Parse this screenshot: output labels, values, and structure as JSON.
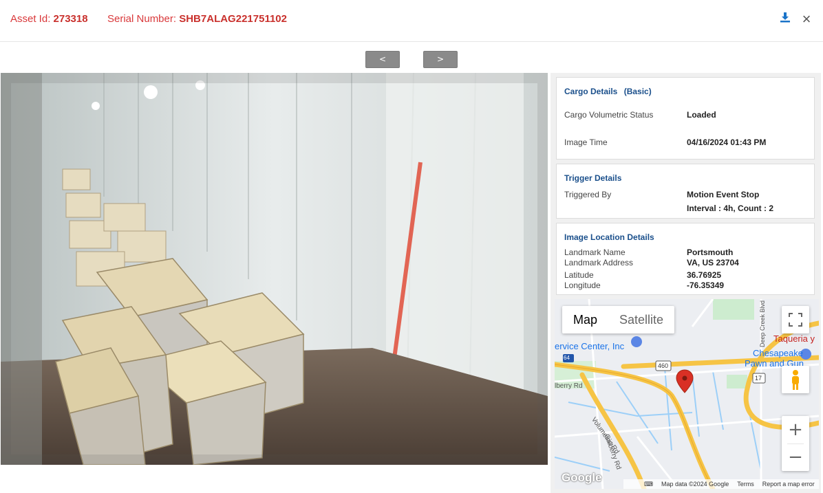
{
  "header": {
    "asset_label": "Asset Id:",
    "asset_value": "273318",
    "serial_label": "Serial Number:",
    "serial_value": "SHB7ALAG221751102",
    "download_icon": "download-icon",
    "close_icon": "close-icon",
    "close_glyph": "×"
  },
  "nav": {
    "prev_label": "<",
    "next_label": ">"
  },
  "cargo": {
    "title": "Cargo Details",
    "basic": "(Basic)",
    "status_label": "Cargo Volumetric Status",
    "status_value": "Loaded",
    "time_label": "Image Time",
    "time_value": "04/16/2024 01:43 PM"
  },
  "trigger": {
    "title": "Trigger Details",
    "by_label": "Triggered By",
    "by_value": "Motion Event Stop",
    "interval_value": "Interval : 4h, Count : 2"
  },
  "location": {
    "title": "Image Location Details",
    "landmark_name_label": "Landmark Name",
    "landmark_name_value": "Portsmouth",
    "landmark_address_label": "Landmark Address",
    "landmark_address_value": "VA, US 23704",
    "latitude_label": "Latitude",
    "latitude_value": "36.76925",
    "longitude_label": "Longitude",
    "longitude_value": "-76.35349"
  },
  "map": {
    "type_map": "Map",
    "type_satellite": "Satellite",
    "zoom_in": "+",
    "zoom_out": "−",
    "labels": {
      "service_center": "ervice Center, Inc",
      "taqueria": "Taqueria y",
      "chesapeake": "Chesapeake",
      "pawn": "Pawn and Gun",
      "galberry": "Galberry Rd",
      "volumetric_rd": "Volumetric Rd",
      "deep_creek": "Deep Creek Blvd",
      "berry_rd": "lberry Rd",
      "route_460": "460",
      "route_17": "17",
      "route_64": "64",
      "google": "Google"
    },
    "footer": {
      "map_data": "Map data ©2024 Google",
      "terms": "Terms",
      "report": "Report a map error"
    },
    "colors": {
      "road_major": "#f6c445",
      "road_minor": "#ffffff",
      "water": "#9ccff8",
      "marker": "#d93025"
    }
  },
  "colors": {
    "header_red": "#d9383a",
    "title_blue": "#1a4f8b",
    "nav_gray": "#8a8a8a"
  }
}
